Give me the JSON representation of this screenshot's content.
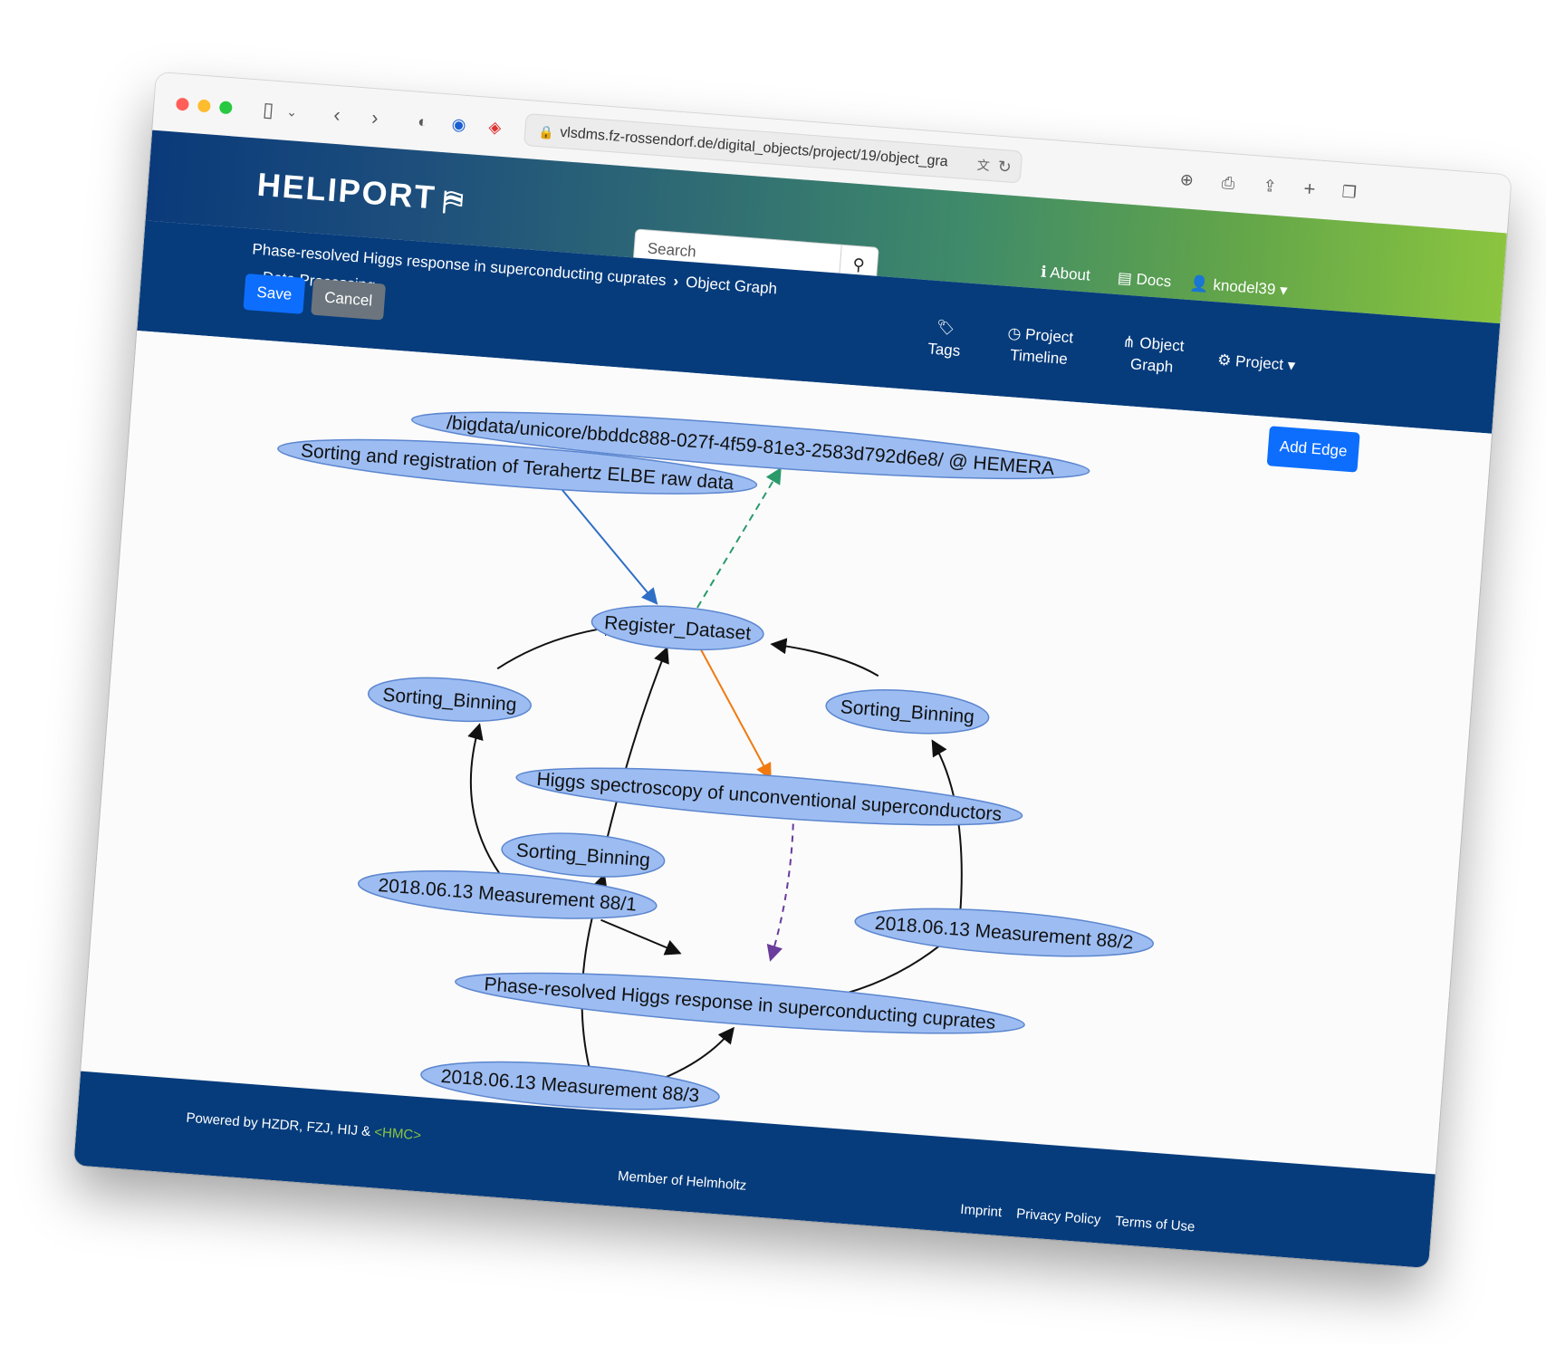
{
  "browser": {
    "url": "vlsdms.fz-rossendorf.de/digital_objects/project/19/object_gra"
  },
  "header": {
    "logo": "HELIPORT",
    "search_placeholder": "Search",
    "about": "About",
    "docs": "Docs",
    "user": "knodel39"
  },
  "breadcrumb": {
    "project": "Phase-resolved Higgs response in superconducting cuprates",
    "page": "Object Graph",
    "sub": "Data Processing"
  },
  "nav": {
    "tags": "Tags",
    "timeline_1": "Project",
    "timeline_2": "Timeline",
    "graph_1": "Object",
    "graph_2": "Graph",
    "project": "Project"
  },
  "actions": {
    "save": "Save",
    "cancel": "Cancel",
    "add_edge": "Add Edge"
  },
  "graph": {
    "nodes": [
      {
        "id": "n1",
        "label": "/bigdata/unicore/bbddc888-027f-4f59-81e3-2583d792d6e8/ @ HEMERA"
      },
      {
        "id": "n2",
        "label": "Sorting and registration of Terahertz ELBE raw data"
      },
      {
        "id": "n3",
        "label": "Register_Dataset"
      },
      {
        "id": "n4",
        "label": "Sorting_Binning"
      },
      {
        "id": "n5",
        "label": "Sorting_Binning"
      },
      {
        "id": "n6",
        "label": "Higgs spectroscopy of unconventional superconductors"
      },
      {
        "id": "n7",
        "label": "Sorting_Binning"
      },
      {
        "id": "n8",
        "label": "2018.06.13 Measurement 88/1"
      },
      {
        "id": "n9",
        "label": "2018.06.13 Measurement 88/2"
      },
      {
        "id": "n10",
        "label": "Phase-resolved Higgs response in superconducting cuprates"
      },
      {
        "id": "n11",
        "label": "2018.06.13 Measurement 88/3"
      }
    ],
    "edge_colors": {
      "default": "#111111",
      "blue": "#2f6fc6",
      "green": "#2a9a6a",
      "orange": "#f07a10",
      "purple": "#6a3c9c"
    },
    "node_fill": "#9dbdf2",
    "node_stroke": "#5c86cf"
  },
  "footer": {
    "powered": "Powered by HZDR, FZJ, HIJ &",
    "hmc": "<HMC>",
    "member": "Member of Helmholtz",
    "imprint": "Imprint",
    "privacy": "Privacy Policy",
    "terms": "Terms of Use"
  }
}
